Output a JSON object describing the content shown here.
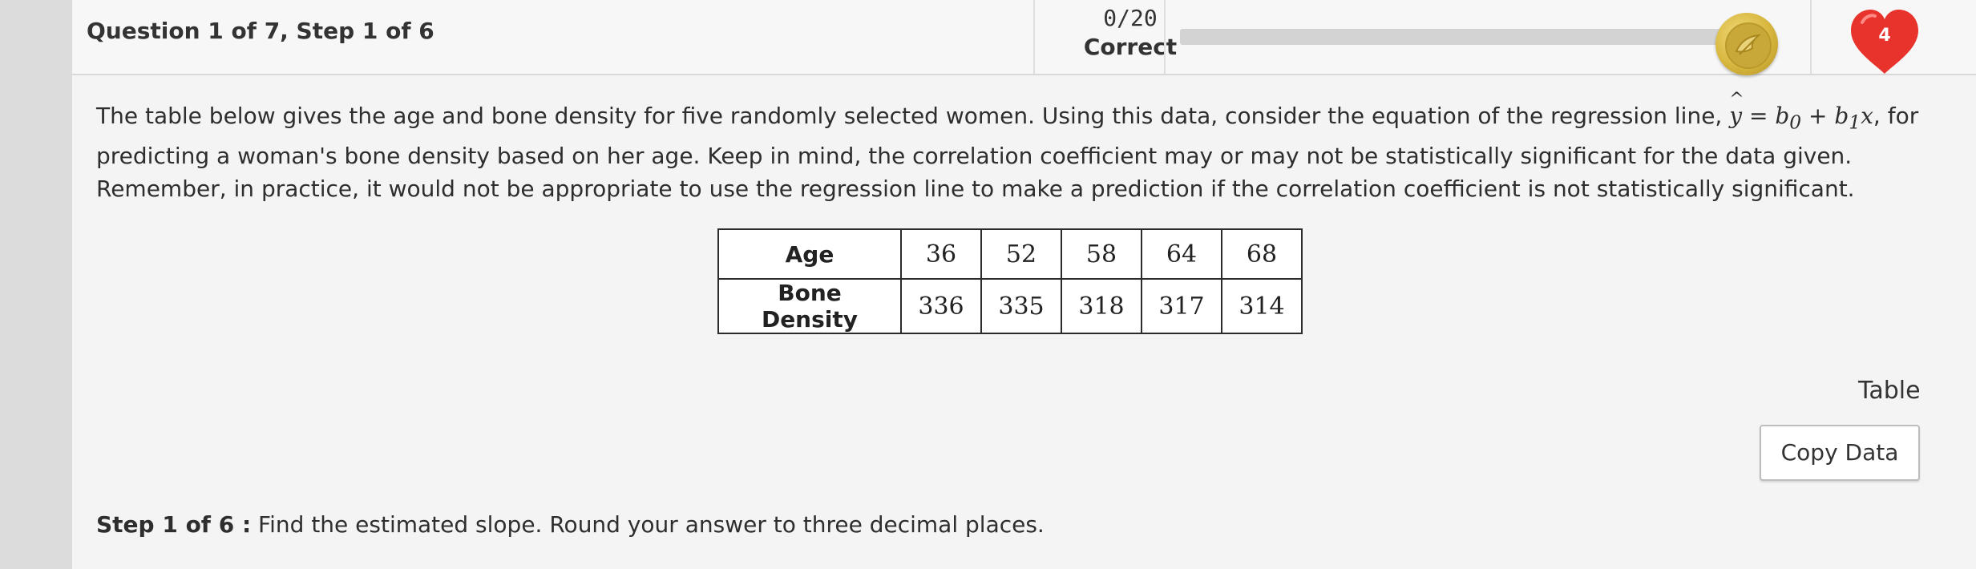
{
  "header": {
    "question_title": "Question 1 of 7, Step 1 of 6",
    "score_fraction": "0/20",
    "score_label": "Correct",
    "progress_fraction": 0.0,
    "lives_count": "4",
    "coin_icon": "coin-icon",
    "heart_icon": "heart-icon"
  },
  "prompt": {
    "part1": "The table below gives the age and bone density for five randomly selected women. Using this data, consider the equation of the regression line, ",
    "eq_yhat": "y",
    "eq_rest": " = b",
    "eq_sub0": "0",
    "eq_plus": " + b",
    "eq_sub1": "1",
    "eq_x": "x",
    "part2": ", for predicting a woman's bone density based on her age. Keep in mind, the correlation coefficient may or may not be statistically significant for the data given. Remember, in practice, it would not be appropriate to use the regression line to make a prediction if the correlation coefficient is not statistically significant."
  },
  "table": {
    "rows": [
      {
        "label": "Age",
        "values": [
          "36",
          "52",
          "58",
          "64",
          "68"
        ]
      },
      {
        "label": "Bone Density",
        "values": [
          "336",
          "335",
          "318",
          "317",
          "314"
        ]
      }
    ]
  },
  "side": {
    "table_link": "Table",
    "copy_button": "Copy Data"
  },
  "step": {
    "label": "Step 1 of 6 :",
    "text": " Find the estimated slope. Round your answer to three decimal places."
  },
  "colors": {
    "heart": "#e8322c",
    "coin": "#d8b73f",
    "progress_track": "#d3d3d3"
  }
}
